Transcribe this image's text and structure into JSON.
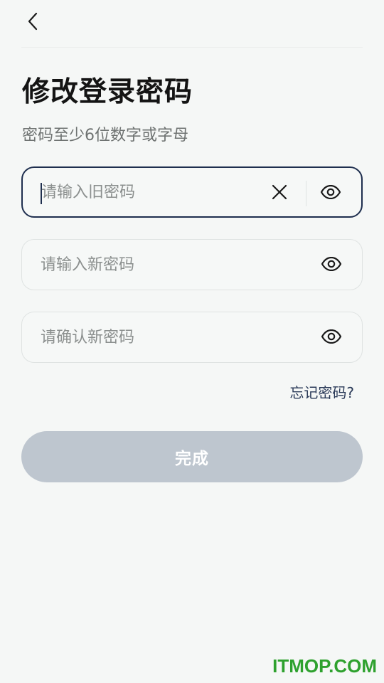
{
  "header": {
    "back_icon": "chevron-left-icon"
  },
  "page": {
    "title": "修改登录密码",
    "subtitle": "密码至少6位数字或字母"
  },
  "fields": [
    {
      "placeholder": "请输入旧密码",
      "value": "",
      "focused": true,
      "clear_icon": "close-icon",
      "eye_icon": "eye-icon"
    },
    {
      "placeholder": "请输入新密码",
      "value": "",
      "focused": false,
      "eye_icon": "eye-icon"
    },
    {
      "placeholder": "请确认新密码",
      "value": "",
      "focused": false,
      "eye_icon": "eye-icon"
    }
  ],
  "forgot_link": "忘记密码?",
  "submit": {
    "label": "完成",
    "enabled": false
  },
  "watermark": "ITMOP.COM",
  "colors": {
    "background": "#f5f7f6",
    "focus_border": "#1f2f4f",
    "submit_disabled": "#bec6cf",
    "link": "#2a3a58",
    "watermark": "#2ea12e"
  }
}
